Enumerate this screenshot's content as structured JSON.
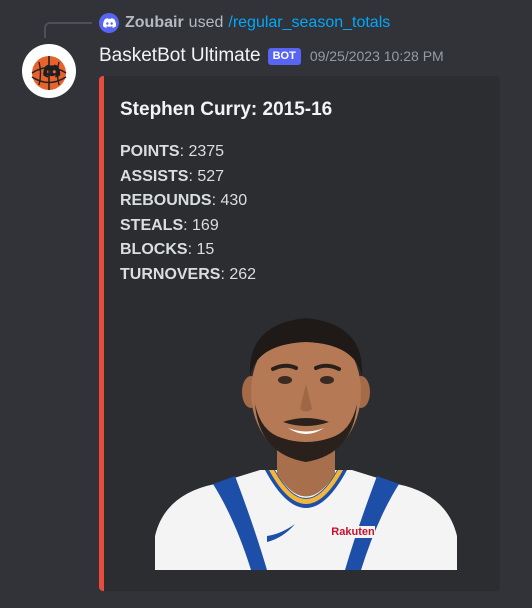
{
  "command": {
    "user": "Zoubair",
    "used_text": "used",
    "command_name": "/regular_season_totals",
    "icon": "discord-icon"
  },
  "author": {
    "name": "BasketBot Ultimate",
    "badge": "BOT",
    "timestamp": "09/25/2023 10:28 PM",
    "avatar_icon": "discord-basketball-avatar"
  },
  "embed": {
    "accent_color": "#e74c3c",
    "title": "Stephen Curry: 2015-16",
    "stats": [
      {
        "label": "POINTS",
        "value": "2375"
      },
      {
        "label": "ASSISTS",
        "value": "527"
      },
      {
        "label": "REBOUNDS",
        "value": "430"
      },
      {
        "label": "STEALS",
        "value": "169"
      },
      {
        "label": "BLOCKS",
        "value": "15"
      },
      {
        "label": "TURNOVERS",
        "value": "262"
      }
    ],
    "image": {
      "icon": "player-headshot",
      "jersey_sponsor": "Rakuten"
    }
  }
}
